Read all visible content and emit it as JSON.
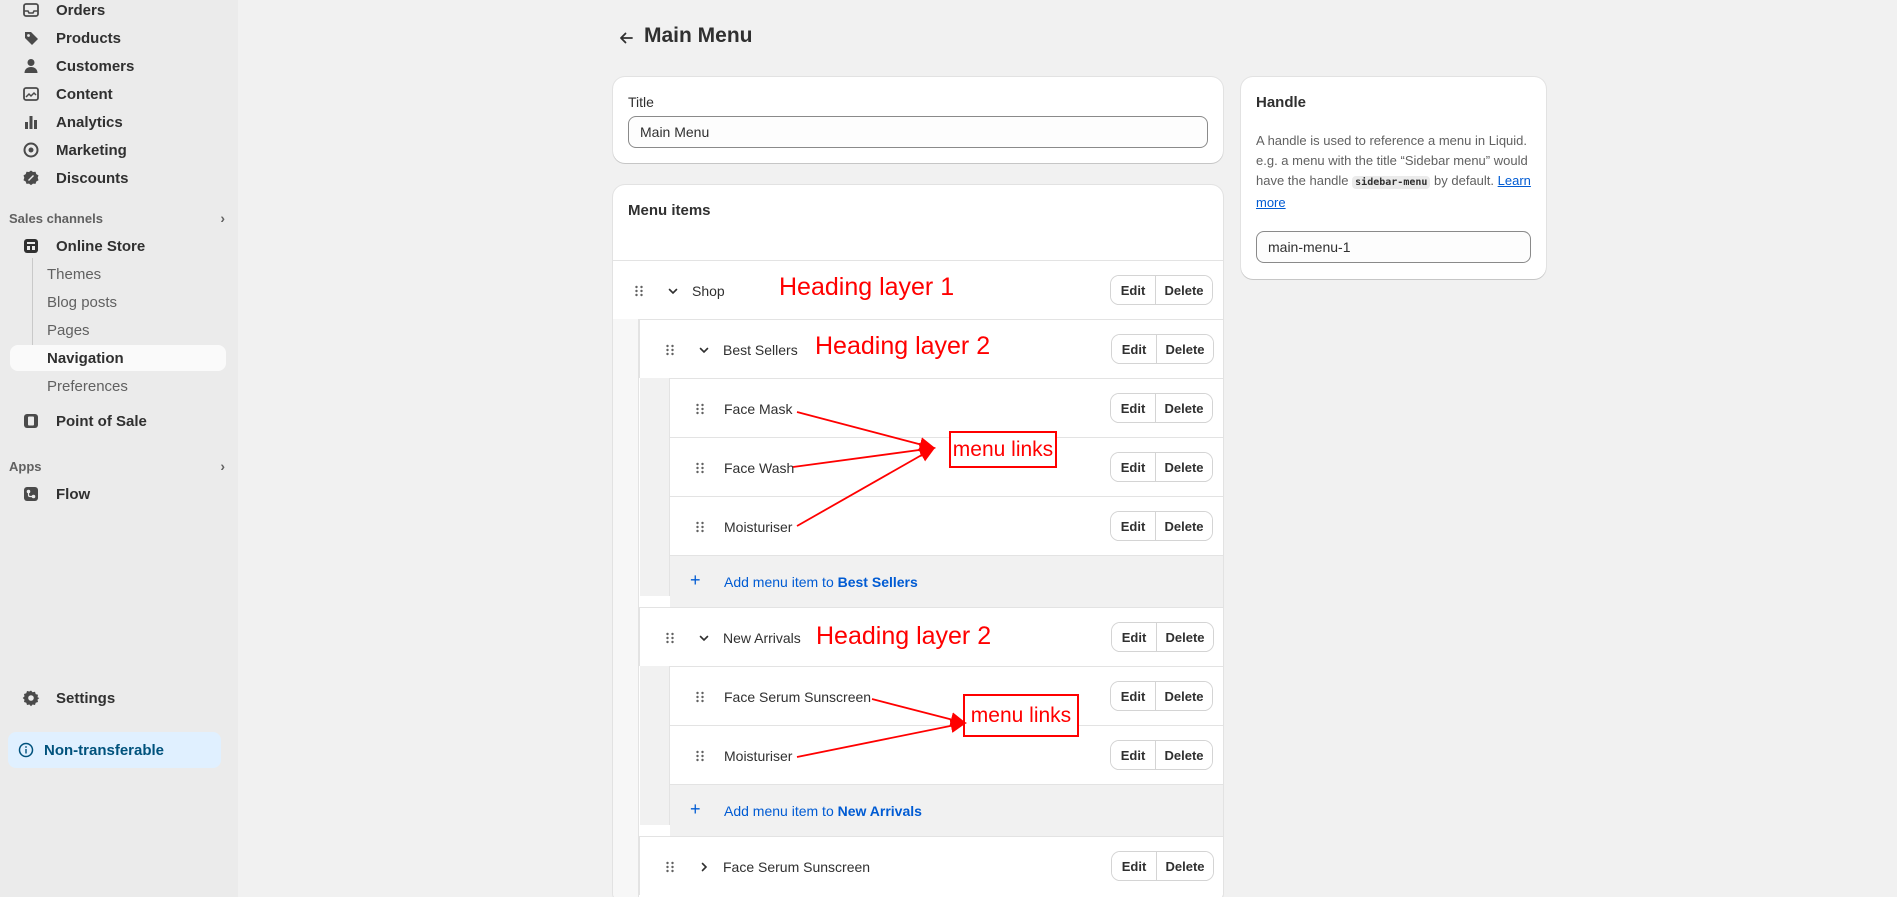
{
  "sidebar": {
    "items": [
      {
        "label": "Orders",
        "icon": "orders-icon"
      },
      {
        "label": "Products",
        "icon": "tag-icon"
      },
      {
        "label": "Customers",
        "icon": "person-icon"
      },
      {
        "label": "Content",
        "icon": "content-icon"
      },
      {
        "label": "Analytics",
        "icon": "bar-chart-icon"
      },
      {
        "label": "Marketing",
        "icon": "target-icon"
      },
      {
        "label": "Discounts",
        "icon": "discount-icon"
      }
    ],
    "sales_channels_label": "Sales channels",
    "online_store": "Online Store",
    "online_store_sub": [
      "Themes",
      "Blog posts",
      "Pages",
      "Navigation",
      "Preferences"
    ],
    "point_of_sale": "Point of Sale",
    "apps_label": "Apps",
    "flow": "Flow",
    "settings": "Settings",
    "non_transferable": "Non-transferable"
  },
  "page": {
    "title": "Main Menu"
  },
  "title_card": {
    "label": "Title",
    "value": "Main Menu"
  },
  "menu_card": {
    "heading": "Menu items",
    "edit_label": "Edit",
    "delete_label": "Delete",
    "rows": {
      "shop": "Shop",
      "best_sellers": "Best Sellers",
      "face_mask": "Face Mask",
      "face_wash": "Face Wash",
      "moisturiser_1": "Moisturiser",
      "add_best_prefix": "Add menu item to",
      "add_best_target": "Best Sellers",
      "new_arrivals": "New Arrivals",
      "face_serum_1": "Face Serum Sunscreen",
      "moisturiser_2": "Moisturiser",
      "add_new_prefix": "Add menu item to",
      "add_new_target": "New Arrivals",
      "face_serum_2": "Face Serum Sunscreen"
    }
  },
  "handle_card": {
    "heading": "Handle",
    "desc_1": "A handle is used to reference a menu in Liquid. e.g. a menu with the title “Sidebar menu” would have the handle",
    "code": "sidebar-menu",
    "desc_2": "by default.",
    "learn_more": "Learn more",
    "value": "main-menu-1"
  },
  "annotations": {
    "heading1": "Heading layer 1",
    "heading2a": "Heading layer 2",
    "heading2b": "Heading layer 2",
    "links_a": "menu links",
    "links_b": "menu links"
  },
  "colors": {
    "annotation": "#ff0000",
    "link": "#005bd3",
    "badge_bg": "#e0f0ff"
  }
}
